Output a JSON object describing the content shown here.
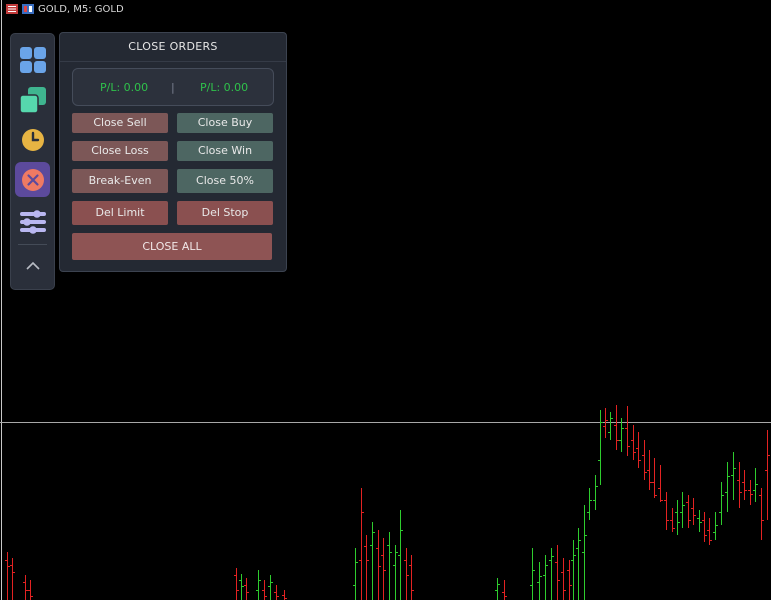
{
  "window": {
    "title": "GOLD, M5:  GOLD"
  },
  "sidebar": {
    "items": [
      {
        "name": "grid-icon",
        "color": "#6aa4e8"
      },
      {
        "name": "layers-icon",
        "color": "#45c9a0"
      },
      {
        "name": "clock-icon",
        "color": "#e7b443"
      },
      {
        "name": "close-circle-icon",
        "color": "#ef7a63",
        "active": true
      },
      {
        "name": "sliders-icon",
        "color": "#b9b7f0"
      },
      {
        "name": "chevron-up-icon",
        "color": "#b8bcc4"
      }
    ]
  },
  "panel": {
    "title": "CLOSE ORDERS",
    "pl_left": "P/L: 0.00",
    "pl_right": "P/L: 0.00",
    "separator": "|",
    "buttons": {
      "close_sell": "Close Sell",
      "close_buy": "Close Buy",
      "close_loss": "Close Loss",
      "close_win": "Close Win",
      "break_even": "Break-Even",
      "close_50": "Close 50%",
      "del_limit": "Del Limit",
      "del_stop": "Del Stop",
      "close_all": "CLOSE ALL"
    }
  },
  "colors": {
    "bull": "#2ecc2e",
    "bear": "#e32222",
    "background": "#000000"
  }
}
